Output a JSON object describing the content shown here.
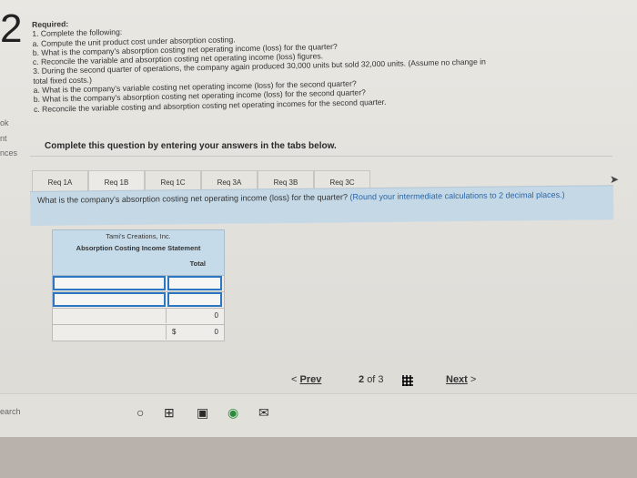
{
  "question": {
    "number": "2"
  },
  "side": {
    "t1": "ok",
    "t2": "nt",
    "t3": "nces",
    "search": "earch"
  },
  "required": {
    "title": "Required:",
    "lines": [
      "1. Complete the following:",
      "a. Compute the unit product cost under absorption costing.",
      "b. What is the company's absorption costing net operating income (loss) for the quarter?",
      "c. Reconcile the variable and absorption costing net operating income (loss) figures.",
      "3. During the second quarter of operations, the company again produced 30,000 units but sold 32,000 units. (Assume no change in",
      "total fixed costs.)",
      "a. What is the company's variable costing net operating income (loss) for the second quarter?",
      "b. What is the company's absorption costing net operating income (loss) for the second quarter?",
      "c. Reconcile the variable costing and absorption costing net operating incomes for the second quarter."
    ]
  },
  "instruction": "Complete this question by entering your answers in the tabs below.",
  "tabs": [
    "Req 1A",
    "Req 1B",
    "Req 1C",
    "Req 3A",
    "Req 3B",
    "Req 3C"
  ],
  "prompt": {
    "text": "What is the company's absorption costing net operating income (loss) for the quarter?",
    "note": "(Round your intermediate calculations to 2 decimal places.)"
  },
  "statement": {
    "company": "Tami's Creations, Inc.",
    "title": "Absorption Costing Income Statement",
    "column": "Total",
    "rows": [
      {
        "amount": ""
      },
      {
        "amount": ""
      },
      {
        "amount": "0"
      },
      {
        "currency": "$",
        "amount": "0"
      }
    ]
  },
  "navigation": {
    "prev": "Prev",
    "page": "2",
    "of": "of 3",
    "next": "Next"
  }
}
